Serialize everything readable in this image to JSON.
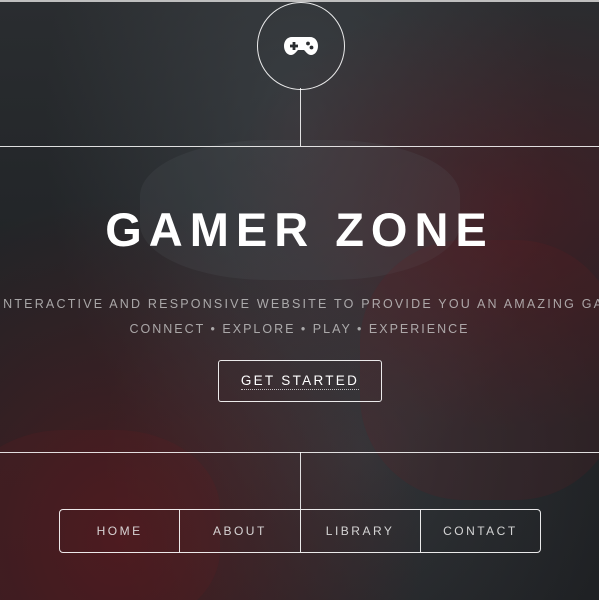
{
  "header": {
    "logo_icon": "gamepad-icon"
  },
  "hero": {
    "title": "GAMER ZONE",
    "tagline": "AN INTERACTIVE AND RESPONSIVE WEBSITE TO PROVIDE YOU AN AMAZING GAMING EXPERIENCE",
    "subline": "CONNECT • EXPLORE • PLAY • EXPERIENCE",
    "cta_label": "GET STARTED"
  },
  "nav": {
    "items": [
      {
        "label": "HOME"
      },
      {
        "label": "ABOUT"
      },
      {
        "label": "LIBRARY"
      },
      {
        "label": "CONTACT"
      }
    ]
  },
  "colors": {
    "line": "#ffffff",
    "text": "#ffffff",
    "muted_text": "#d2d2d2"
  }
}
